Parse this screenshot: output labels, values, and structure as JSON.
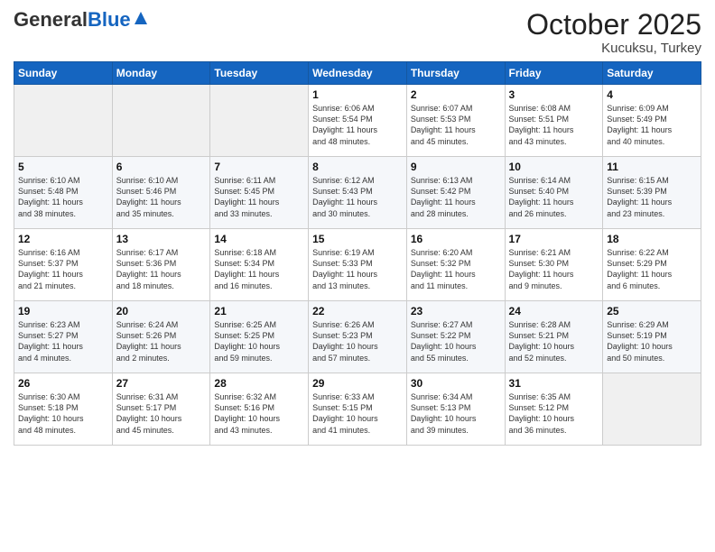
{
  "logo": {
    "general": "General",
    "blue": "Blue"
  },
  "header": {
    "month": "October 2025",
    "location": "Kucuksu, Turkey"
  },
  "weekdays": [
    "Sunday",
    "Monday",
    "Tuesday",
    "Wednesday",
    "Thursday",
    "Friday",
    "Saturday"
  ],
  "weeks": [
    [
      {
        "day": "",
        "info": ""
      },
      {
        "day": "",
        "info": ""
      },
      {
        "day": "",
        "info": ""
      },
      {
        "day": "1",
        "info": "Sunrise: 6:06 AM\nSunset: 5:54 PM\nDaylight: 11 hours\nand 48 minutes."
      },
      {
        "day": "2",
        "info": "Sunrise: 6:07 AM\nSunset: 5:53 PM\nDaylight: 11 hours\nand 45 minutes."
      },
      {
        "day": "3",
        "info": "Sunrise: 6:08 AM\nSunset: 5:51 PM\nDaylight: 11 hours\nand 43 minutes."
      },
      {
        "day": "4",
        "info": "Sunrise: 6:09 AM\nSunset: 5:49 PM\nDaylight: 11 hours\nand 40 minutes."
      }
    ],
    [
      {
        "day": "5",
        "info": "Sunrise: 6:10 AM\nSunset: 5:48 PM\nDaylight: 11 hours\nand 38 minutes."
      },
      {
        "day": "6",
        "info": "Sunrise: 6:10 AM\nSunset: 5:46 PM\nDaylight: 11 hours\nand 35 minutes."
      },
      {
        "day": "7",
        "info": "Sunrise: 6:11 AM\nSunset: 5:45 PM\nDaylight: 11 hours\nand 33 minutes."
      },
      {
        "day": "8",
        "info": "Sunrise: 6:12 AM\nSunset: 5:43 PM\nDaylight: 11 hours\nand 30 minutes."
      },
      {
        "day": "9",
        "info": "Sunrise: 6:13 AM\nSunset: 5:42 PM\nDaylight: 11 hours\nand 28 minutes."
      },
      {
        "day": "10",
        "info": "Sunrise: 6:14 AM\nSunset: 5:40 PM\nDaylight: 11 hours\nand 26 minutes."
      },
      {
        "day": "11",
        "info": "Sunrise: 6:15 AM\nSunset: 5:39 PM\nDaylight: 11 hours\nand 23 minutes."
      }
    ],
    [
      {
        "day": "12",
        "info": "Sunrise: 6:16 AM\nSunset: 5:37 PM\nDaylight: 11 hours\nand 21 minutes."
      },
      {
        "day": "13",
        "info": "Sunrise: 6:17 AM\nSunset: 5:36 PM\nDaylight: 11 hours\nand 18 minutes."
      },
      {
        "day": "14",
        "info": "Sunrise: 6:18 AM\nSunset: 5:34 PM\nDaylight: 11 hours\nand 16 minutes."
      },
      {
        "day": "15",
        "info": "Sunrise: 6:19 AM\nSunset: 5:33 PM\nDaylight: 11 hours\nand 13 minutes."
      },
      {
        "day": "16",
        "info": "Sunrise: 6:20 AM\nSunset: 5:32 PM\nDaylight: 11 hours\nand 11 minutes."
      },
      {
        "day": "17",
        "info": "Sunrise: 6:21 AM\nSunset: 5:30 PM\nDaylight: 11 hours\nand 9 minutes."
      },
      {
        "day": "18",
        "info": "Sunrise: 6:22 AM\nSunset: 5:29 PM\nDaylight: 11 hours\nand 6 minutes."
      }
    ],
    [
      {
        "day": "19",
        "info": "Sunrise: 6:23 AM\nSunset: 5:27 PM\nDaylight: 11 hours\nand 4 minutes."
      },
      {
        "day": "20",
        "info": "Sunrise: 6:24 AM\nSunset: 5:26 PM\nDaylight: 11 hours\nand 2 minutes."
      },
      {
        "day": "21",
        "info": "Sunrise: 6:25 AM\nSunset: 5:25 PM\nDaylight: 10 hours\nand 59 minutes."
      },
      {
        "day": "22",
        "info": "Sunrise: 6:26 AM\nSunset: 5:23 PM\nDaylight: 10 hours\nand 57 minutes."
      },
      {
        "day": "23",
        "info": "Sunrise: 6:27 AM\nSunset: 5:22 PM\nDaylight: 10 hours\nand 55 minutes."
      },
      {
        "day": "24",
        "info": "Sunrise: 6:28 AM\nSunset: 5:21 PM\nDaylight: 10 hours\nand 52 minutes."
      },
      {
        "day": "25",
        "info": "Sunrise: 6:29 AM\nSunset: 5:19 PM\nDaylight: 10 hours\nand 50 minutes."
      }
    ],
    [
      {
        "day": "26",
        "info": "Sunrise: 6:30 AM\nSunset: 5:18 PM\nDaylight: 10 hours\nand 48 minutes."
      },
      {
        "day": "27",
        "info": "Sunrise: 6:31 AM\nSunset: 5:17 PM\nDaylight: 10 hours\nand 45 minutes."
      },
      {
        "day": "28",
        "info": "Sunrise: 6:32 AM\nSunset: 5:16 PM\nDaylight: 10 hours\nand 43 minutes."
      },
      {
        "day": "29",
        "info": "Sunrise: 6:33 AM\nSunset: 5:15 PM\nDaylight: 10 hours\nand 41 minutes."
      },
      {
        "day": "30",
        "info": "Sunrise: 6:34 AM\nSunset: 5:13 PM\nDaylight: 10 hours\nand 39 minutes."
      },
      {
        "day": "31",
        "info": "Sunrise: 6:35 AM\nSunset: 5:12 PM\nDaylight: 10 hours\nand 36 minutes."
      },
      {
        "day": "",
        "info": ""
      }
    ]
  ]
}
